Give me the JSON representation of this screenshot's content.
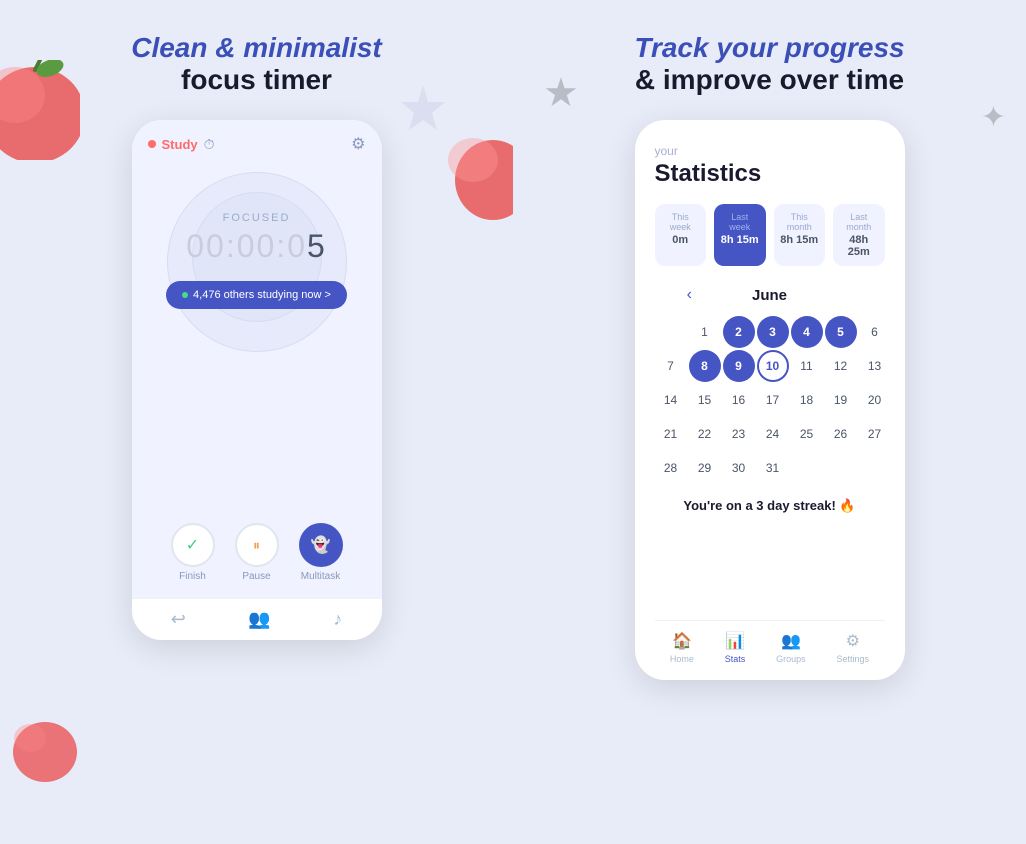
{
  "left_panel": {
    "title_italic": "Clean & minimalist",
    "title_normal": "focus timer",
    "phone": {
      "header": {
        "study_label": "Study",
        "timer_icon": "⏱",
        "gear_icon": "⚙"
      },
      "body": {
        "focused_label": "FOCUSED",
        "timer": "00:00:0",
        "timer_bold_digit": "5",
        "others_btn": "4,476 others studying now >"
      },
      "actions": [
        {
          "label": "Finish",
          "icon": "✓",
          "style": "white"
        },
        {
          "label": "Pause",
          "icon": "⏸",
          "style": "white"
        },
        {
          "label": "Multitask",
          "icon": "👻",
          "style": "blue"
        }
      ],
      "footer_icons": [
        "↩",
        "👥",
        "♪"
      ]
    }
  },
  "right_panel": {
    "title_italic": "Track your progress",
    "title_normal": "& improve over time",
    "phone": {
      "stats_subtitle": "your",
      "stats_title": "Statistics",
      "stats": [
        {
          "period": "This week",
          "value": "0m",
          "active": false
        },
        {
          "period": "Last week",
          "value": "8h 15m",
          "active": true
        },
        {
          "period": "This month",
          "value": "8h 15m",
          "active": false
        },
        {
          "period": "Last month",
          "value": "48h 25m",
          "active": false
        }
      ],
      "calendar": {
        "month": "June",
        "nav_prev": "‹",
        "nav_next": "",
        "days": [
          {
            "n": "",
            "state": "empty"
          },
          {
            "n": "1",
            "state": "normal"
          },
          {
            "n": "2",
            "state": "filled"
          },
          {
            "n": "3",
            "state": "filled"
          },
          {
            "n": "4",
            "state": "filled"
          },
          {
            "n": "5",
            "state": "filled"
          },
          {
            "n": "6",
            "state": "normal"
          },
          {
            "n": "7",
            "state": "normal"
          },
          {
            "n": "8",
            "state": "filled"
          },
          {
            "n": "9",
            "state": "filled"
          },
          {
            "n": "10",
            "state": "today"
          },
          {
            "n": "11",
            "state": "normal"
          },
          {
            "n": "12",
            "state": "normal"
          },
          {
            "n": "13",
            "state": "normal"
          },
          {
            "n": "14",
            "state": "normal"
          },
          {
            "n": "15",
            "state": "normal"
          },
          {
            "n": "16",
            "state": "normal"
          },
          {
            "n": "17",
            "state": "normal"
          },
          {
            "n": "18",
            "state": "normal"
          },
          {
            "n": "19",
            "state": "normal"
          },
          {
            "n": "20",
            "state": "normal"
          },
          {
            "n": "21",
            "state": "normal"
          },
          {
            "n": "22",
            "state": "normal"
          },
          {
            "n": "23",
            "state": "normal"
          },
          {
            "n": "24",
            "state": "normal"
          },
          {
            "n": "25",
            "state": "normal"
          },
          {
            "n": "26",
            "state": "normal"
          },
          {
            "n": "27",
            "state": "normal"
          },
          {
            "n": "28",
            "state": "normal"
          },
          {
            "n": "29",
            "state": "normal"
          },
          {
            "n": "30",
            "state": "normal"
          },
          {
            "n": "31",
            "state": "normal"
          }
        ]
      },
      "streak_text": "You're on a 3 day streak! 🔥",
      "footer": [
        {
          "icon": "🏠",
          "label": "Home",
          "active": false
        },
        {
          "icon": "📊",
          "label": "Stats",
          "active": true
        },
        {
          "icon": "👥",
          "label": "Groups",
          "active": false
        },
        {
          "icon": "⚙",
          "label": "Settings",
          "active": false
        }
      ]
    }
  }
}
